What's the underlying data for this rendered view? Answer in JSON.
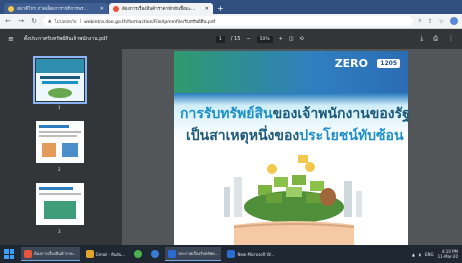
{
  "browser": {
    "tabs": [
      {
        "title": "สมาคิโกร ภาคเอ็ดเการาชกิการพร...",
        "active": false
      },
      {
        "title": "ต้องการเรื่องสินค้าราคาทักทันชื้อมะ...",
        "active": true
      }
    ],
    "url_prefix": "ไม่ปลอดภัย",
    "url": "webintra.doe.go.th/formaction/File/Ipmmfile/รับทรัพย์สิน.pdf"
  },
  "pdf": {
    "filename": "ตั้งประกาศรับทรัพย์สินเจ้าพนักงาน.pdf",
    "page_current": "1",
    "page_total": "/ 15",
    "zoom": "50%",
    "thumbnails": [
      "1",
      "2",
      "3"
    ]
  },
  "document": {
    "logo_text": "ZERO",
    "hotline": "1205",
    "headline1_a": "การรับทรัพย์สิน",
    "headline1_b": "ของเจ้าพนักงานของรัฐ",
    "headline2_a": "เป็นสาเหตุหนึ่งของ",
    "headline2_b": "ประโยชน์ทับซ้อน"
  },
  "taskbar": {
    "items": [
      {
        "label": "ต้องการเรื่องสินค้าราค...",
        "color": "#e8543a",
        "active": true
      },
      {
        "label": "Gmail - ยืนยัน...",
        "color": "#e0a52a",
        "active": false
      },
      {
        "label": "",
        "color": "#4caf50",
        "active": false
      },
      {
        "label": "",
        "color": "#3a7bd5",
        "active": false
      },
      {
        "label": "ประกาศเรื่องรับทรัพย...",
        "color": "#2b6cd4",
        "active": true
      },
      {
        "label": "New Microsoft W...",
        "color": "#2b6cd4",
        "active": false
      }
    ],
    "lang": "ENG",
    "time": "4:10 PM",
    "date": "11-Mar-20"
  }
}
